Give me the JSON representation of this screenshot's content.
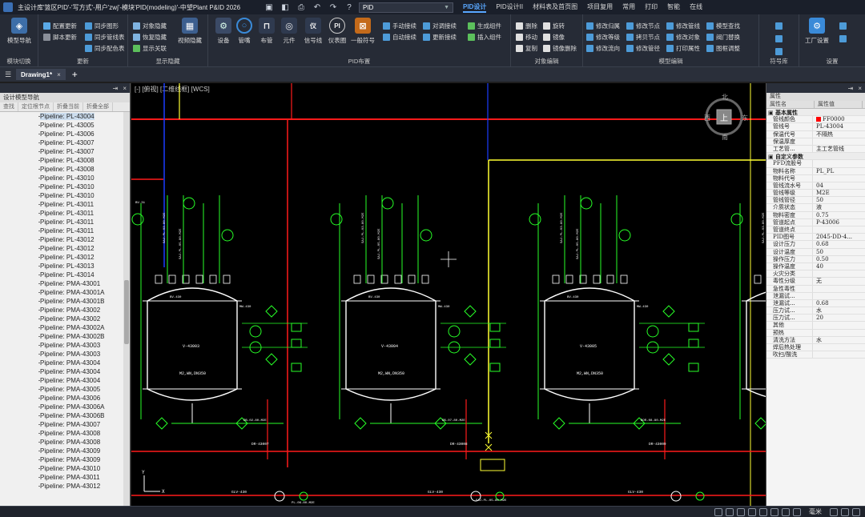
{
  "window": {
    "title": "主设计库'篮区PID'-'写方式'-用户'zwj'-模块'PID(modeling)'-中望Plant P&ID 2026",
    "command_box": "PID"
  },
  "menu_tabs": [
    "PID设计",
    "PID设计II",
    "材料表及首页图",
    "项目复用",
    "常用",
    "打印",
    "智能",
    "在线"
  ],
  "ribbon": {
    "groups": {
      "module_switch": "模块切换",
      "update": "更新",
      "display_hide": "显示隐藏",
      "pid_layout": "PID布置",
      "object_edit": "对象编辑",
      "model_edit": "模型编辑",
      "symbol_lib": "符号库",
      "settings": "设置"
    },
    "model_nav": "模型导航",
    "update_items": [
      "配置更新",
      "脚本更新",
      "同步图形",
      "同步管线表",
      "同步配色表"
    ],
    "hide_items": [
      "对象隐藏",
      "恢复隐藏",
      "显示关联",
      "视频隐藏"
    ],
    "layout_big": [
      "设备",
      "管嘴",
      "布管",
      "元件",
      "信号线",
      "仪表圈",
      "一般符号"
    ],
    "layout_small": [
      "手动接续",
      "自动接续",
      "对调接续",
      "更新接续",
      "生成组件",
      "插入组件"
    ],
    "edit_small": [
      "删除",
      "移动",
      "复制",
      "旋转",
      "镜像",
      "镜像删除"
    ],
    "model_small": [
      "修改归属",
      "修改等级",
      "修改流向",
      "修改节点",
      "拷贝节点",
      "修改管径",
      "修改管线",
      "修改对象",
      "打印属性",
      "模型查找",
      "阀门替换",
      "图框调整"
    ],
    "factory_settings": "工厂设置"
  },
  "doc_tab": "Drawing1*",
  "left_panel": {
    "title": "设计模型导航",
    "tools": [
      "查找",
      "定位根节点",
      "折叠当前",
      "折叠全部"
    ],
    "items": [
      "Pipeline: PL-43004",
      "Pipeline: PL-43005",
      "Pipeline: PL-43006",
      "Pipeline: PL-43007",
      "Pipeline: PL-43007",
      "Pipeline: PL-43008",
      "Pipeline: PL-43008",
      "Pipeline: PL-43010",
      "Pipeline: PL-43010",
      "Pipeline: PL-43010",
      "Pipeline: PL-43011",
      "Pipeline: PL-43011",
      "Pipeline: PL-43011",
      "Pipeline: PL-43011",
      "Pipeline: PL-43012",
      "Pipeline: PL-43012",
      "Pipeline: PL-43012",
      "Pipeline: PL-43013",
      "Pipeline: PL-43014",
      "Pipeline: PMA-43001",
      "Pipeline: PMA-43001A",
      "Pipeline: PMA-43001B",
      "Pipeline: PMA-43002",
      "Pipeline: PMA-43002",
      "Pipeline: PMA-43002A",
      "Pipeline: PMA-43002B",
      "Pipeline: PMA-43003",
      "Pipeline: PMA-43003",
      "Pipeline: PMA-43004",
      "Pipeline: PMA-43004",
      "Pipeline: PMA-43004",
      "Pipeline: PMA-43005",
      "Pipeline: PMA-43006",
      "Pipeline: PMA-43006A",
      "Pipeline: PMA-43006B",
      "Pipeline: PMA-43007",
      "Pipeline: PMA-43008",
      "Pipeline: PMA-43008",
      "Pipeline: PMA-43009",
      "Pipeline: PMA-43009",
      "Pipeline: PMA-43010",
      "Pipeline: PMA-43011",
      "Pipeline: PMA-43012"
    ]
  },
  "canvas": {
    "view_label": "[-] [俯视] [二维线框] [WCS]",
    "viewcube": {
      "top": "上",
      "north": "北",
      "south": "南",
      "west": "西",
      "east": "东"
    },
    "vessels": [
      "V-43003",
      "V-43004",
      "V-43005"
    ],
    "vessel_spec": "M2,WN,DN350",
    "drains": [
      "DR-43007",
      "DR-43008",
      "DR-43009"
    ],
    "labels": {
      "glv": "GLV-430",
      "bv": "BV-430",
      "mw": "MW-430",
      "line_codes": [
        "DB-02-80-M2E",
        "DB-07-80-M2E",
        "BOR-08-80-M2E",
        "BOR-09-80-M2E",
        "SAJ-PL-03-80-M2E",
        "SAJ-PL-05-80-M2E",
        "PL-06-80-M2E",
        "BV-31"
      ],
      "axis_x": "X",
      "axis_y": "Y"
    },
    "colors": {
      "main_line": "#ff1a1a",
      "green": "#27ff27",
      "yellow": "#ffff33",
      "blue": "#1a3cff",
      "white": "#ffffff"
    }
  },
  "right_panel": {
    "title": "属性",
    "col_name": "属性名",
    "col_value": "属性值",
    "rows": [
      {
        "cat": true,
        "k": "基本属性"
      },
      {
        "k": "管线颜色",
        "v": "FF0000",
        "swatch": true
      },
      {
        "k": "管线号",
        "v": "PL-43004"
      },
      {
        "k": "保温代号",
        "v": "不隔热"
      },
      {
        "k": "保温厚度",
        "v": ""
      },
      {
        "k": "工艺管...",
        "v": "主工艺管线"
      },
      {
        "cat": true,
        "k": "自定义参数"
      },
      {
        "k": "PFD流股号",
        "v": ""
      },
      {
        "k": "物料名称",
        "v": "PL_PL"
      },
      {
        "k": "物料代号",
        "v": ""
      },
      {
        "k": "管线流水号",
        "v": "04"
      },
      {
        "k": "管线等级",
        "v": "M2E"
      },
      {
        "k": "管线管径",
        "v": "50"
      },
      {
        "k": "介质状态",
        "v": "液"
      },
      {
        "k": "物料密度",
        "v": "0.75"
      },
      {
        "k": "管道起点",
        "v": "P-43006"
      },
      {
        "k": "管道终点",
        "v": ""
      },
      {
        "k": "PID图号",
        "v": "2045-DD-4..."
      },
      {
        "k": "设计压力",
        "v": "0.68"
      },
      {
        "k": "设计温度",
        "v": "50"
      },
      {
        "k": "操作压力",
        "v": "0.50"
      },
      {
        "k": "操作温度",
        "v": "40"
      },
      {
        "k": "火灾分类",
        "v": ""
      },
      {
        "k": "毒性分级",
        "v": "无"
      },
      {
        "k": "急性毒性",
        "v": ""
      },
      {
        "k": "泄漏试...",
        "v": ""
      },
      {
        "k": "泄漏试...",
        "v": "0.68"
      },
      {
        "k": "压力试...",
        "v": "水"
      },
      {
        "k": "压力试...",
        "v": "20"
      },
      {
        "k": "其他",
        "v": ""
      },
      {
        "k": "预热",
        "v": ""
      },
      {
        "k": "清洗方法",
        "v": "水"
      },
      {
        "k": "焊后热处理",
        "v": ""
      },
      {
        "k": "吹扫/酸洗",
        "v": ""
      }
    ]
  },
  "status": {
    "unit": "毫米"
  }
}
